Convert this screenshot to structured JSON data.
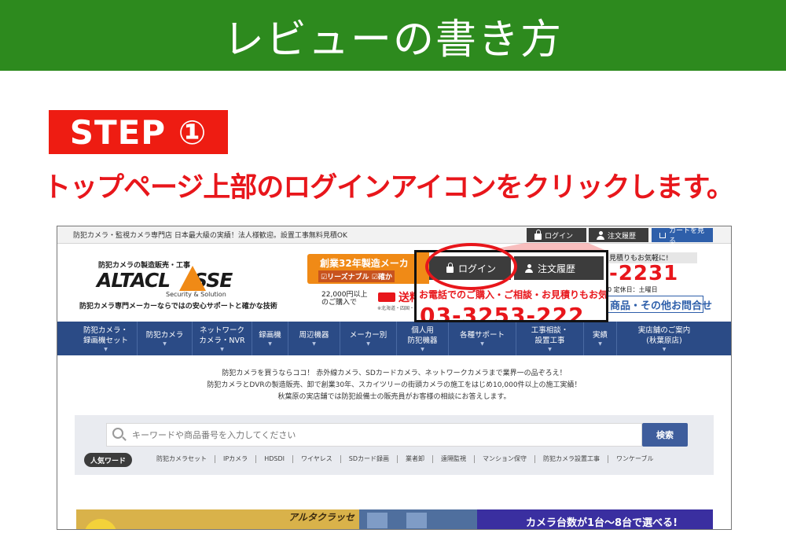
{
  "banner": {
    "title": "レビューの書き方"
  },
  "step": {
    "label": "STEP ①",
    "instruction": "トップページ上部のログインアイコンをクリックします。"
  },
  "colors": {
    "banner_green": "#2d8a1e",
    "step_red": "#ee1c12",
    "instruction_red": "#e8161b",
    "nav_blue": "#2b4b86"
  },
  "site": {
    "topbar": {
      "text": "防犯カメラ・監視カメラ専門店 日本最大級の実績！法人様歓迎。設置工事無料見積OK",
      "login_label": "ログイン",
      "order_label": "注文履歴",
      "cart_label": "カートを見る"
    },
    "logo": {
      "subtitle": "防犯カメラの製造販売・工事",
      "name_left": "ALTACL",
      "name_right": "SSE",
      "security": "Security & Solution",
      "tagline": "防犯カメラ専門メーカーならではの安心サポートと確かな技術"
    },
    "promo": {
      "line1": "創業32年製造メーカ",
      "line2": "☑リーズナブル ☑確か",
      "shipping_amount": "22,000円以上",
      "shipping_purchase": "のご購入で",
      "shipping_free": "送料",
      "shipping_note": "※北海道・四国・"
    },
    "contact": {
      "header": "見積りもお気軽に!",
      "phone": "-2231",
      "hours": "0 定休日：土曜日",
      "button": "商品・その他お問合せ"
    },
    "nav": [
      {
        "l1": "防犯カメラ・",
        "l2": "録画機セット"
      },
      {
        "l1": "防犯カメラ",
        "l2": ""
      },
      {
        "l1": "ネットワーク",
        "l2": "カメラ・NVR"
      },
      {
        "l1": "録画機",
        "l2": ""
      },
      {
        "l1": "周辺機器",
        "l2": ""
      },
      {
        "l1": "メーカー別",
        "l2": ""
      },
      {
        "l1": "個人用",
        "l2": "防犯機器"
      },
      {
        "l1": "各種サポート",
        "l2": ""
      },
      {
        "l1": "工事相談・",
        "l2": "設置工事"
      },
      {
        "l1": "実績",
        "l2": ""
      },
      {
        "l1": "実店舗のご案内",
        "l2": "(秋葉原店)"
      }
    ],
    "intro": [
      "防犯カメラを買うならココ！ 赤外線カメラ、SDカードカメラ、ネットワークカメラまで業界一の品ぞろえ！",
      "防犯カメラとDVRの製造販売、卸で創業30年、スカイツリーの街頭カメラの施工をはじめ10,000件以上の施工実績！",
      "秋葉原の実店舗では防犯設備士の販売員がお客様の相談にお答えします。"
    ],
    "search": {
      "placeholder": "キーワードや商品番号を入力してください",
      "button": "検索",
      "popular_label": "人気ワード",
      "keywords": [
        "防犯カメラセット",
        "IPカメラ",
        "HDSDI",
        "ワイヤレス",
        "SDカード録画",
        "業者卸",
        "遠隔監視",
        "マンション保守",
        "防犯カメラ設置工事",
        "ワンケーブル"
      ]
    },
    "bottom": {
      "brand": "アルタクラッセ",
      "camera_count": "カメラ台数が1台〜8台で選べる!"
    }
  },
  "zoom": {
    "login_label": "ログイン",
    "order_label": "注文履歴",
    "line2": "お電話でのご購入・ご相談・お見積りもお気軽",
    "line3": "03-3253-222"
  }
}
